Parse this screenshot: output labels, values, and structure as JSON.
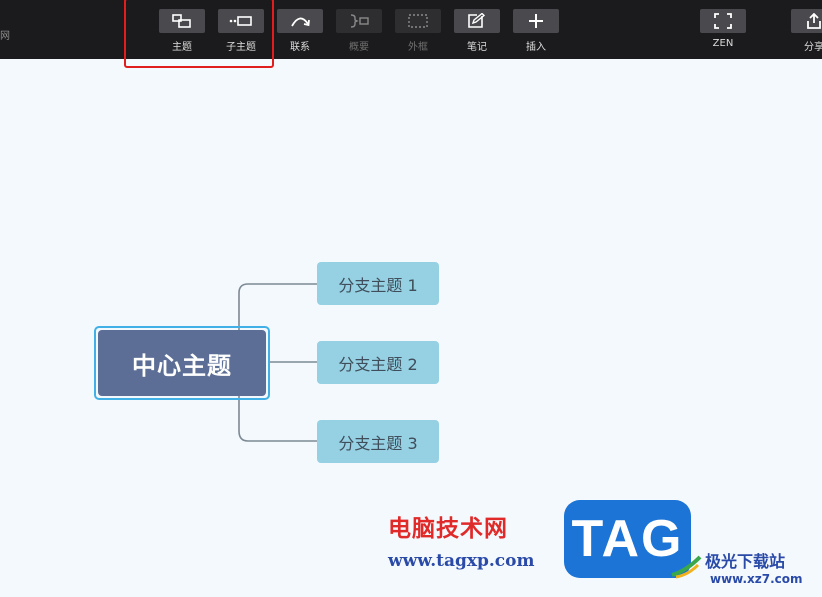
{
  "app": {
    "top_left_fragment": "网"
  },
  "toolbar": {
    "buttons": [
      {
        "label": "主题",
        "icon": "topic-icon",
        "enabled": true
      },
      {
        "label": "子主题",
        "icon": "subtopic-icon",
        "enabled": true
      },
      {
        "label": "联系",
        "icon": "relationship-icon",
        "enabled": true
      },
      {
        "label": "概要",
        "icon": "summary-icon",
        "enabled": false
      },
      {
        "label": "外框",
        "icon": "boundary-icon",
        "enabled": false
      },
      {
        "label": "笔记",
        "icon": "note-icon",
        "enabled": true
      },
      {
        "label": "插入",
        "icon": "plus-icon",
        "enabled": true
      },
      {
        "label": "ZEN",
        "icon": "fullscreen-icon",
        "enabled": true
      },
      {
        "label": "分享",
        "icon": "share-icon",
        "enabled": true
      }
    ]
  },
  "mindmap": {
    "central_topic": "中心主题",
    "branches": [
      {
        "label": "分支主题 1"
      },
      {
        "label": "分支主题 2"
      },
      {
        "label": "分支主题 3"
      }
    ]
  },
  "watermark": {
    "cn_name": "电脑技术网",
    "url": "www.tagxp.com",
    "logo_text": "TAG",
    "site_name": "极光下载站",
    "site_url": "www.xz7.com"
  },
  "colors": {
    "toolbar_bg": "#1b1b1d",
    "canvas_bg": "#f4f9fd",
    "central_topic": "#5c6e96",
    "branch_topic": "#95d0e3",
    "highlight_box": "#e01e1e"
  }
}
